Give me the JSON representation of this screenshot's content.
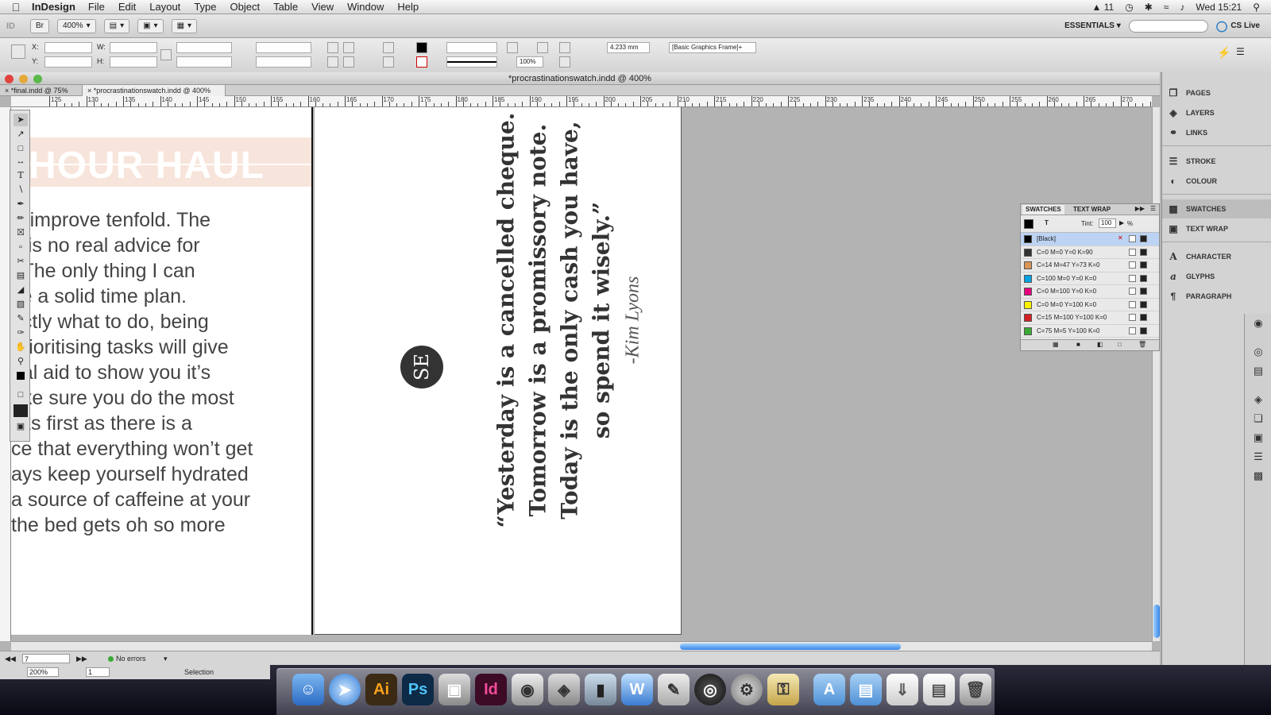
{
  "menubar": {
    "app_name": "InDesign",
    "items": [
      "File",
      "Edit",
      "Layout",
      "Type",
      "Object",
      "Table",
      "View",
      "Window",
      "Help"
    ],
    "status_count": "11",
    "clock": "Wed 15:21"
  },
  "appbar": {
    "id_logo": "ID",
    "bridge": "Br",
    "zoom": "400%",
    "workspace": "ESSENTIALS",
    "cs_live": "CS Live"
  },
  "control": {
    "x_label": "X:",
    "y_label": "Y:",
    "w_label": "W:",
    "h_label": "H:",
    "stroke_weight": "4.233 mm",
    "opacity": "100%",
    "object_style": "[Basic Graphics Frame]+"
  },
  "document": {
    "window_title": "*procrastinationswatch.indd @ 400%",
    "tabs": [
      "*final.indd @ 75%",
      "*procrastinationswatch.indd @ 400%"
    ],
    "ruler_numbers": [
      "125",
      "130",
      "135",
      "140",
      "145",
      "150",
      "155",
      "160",
      "165",
      "170",
      "175",
      "180",
      "185",
      "190",
      "195",
      "200",
      "205",
      "210",
      "215",
      "220",
      "225",
      "230",
      "235",
      "240",
      "245",
      "250",
      "255",
      "260",
      "265",
      "270"
    ],
    "left_page": {
      "headline": "HOUR HAUL",
      "body_lines": [
        "ill improve tenfold.  The",
        "e is no real advice for",
        ".  The only thing I can",
        "ke a solid time plan.",
        "actly what to do, being",
        " prioritising tasks will give",
        "ual aid to show you it’s",
        "ake sure you do the most",
        "sks first as there is a",
        "ce that everything won’t get",
        "ays keep yourself hydrated",
        "a source of caffeine at your",
        " the bed gets oh so more"
      ]
    },
    "right_page": {
      "logo_text": "SE",
      "quote_lines": [
        "“Yesterday is a cancelled cheque.",
        "Tomorrow is a promissory note.",
        "Today is the only cash you have,",
        "so spend it wisely.”"
      ],
      "author": "-Kim Lyons"
    },
    "status": {
      "page": "7",
      "errors": "No errors"
    }
  },
  "swatches_panel": {
    "tabs": [
      "SWATCHES",
      "TEXT WRAP"
    ],
    "tint_label": "Tint:",
    "tint_value": "100",
    "tint_unit": "%",
    "rows": [
      {
        "name": "[Black]",
        "color": "#000000"
      },
      {
        "name": "C=0 M=0 Y=0 K=90",
        "color": "#333333"
      },
      {
        "name": "C=14 M=47 Y=73 K=0",
        "color": "#d9955a"
      },
      {
        "name": "C=100 M=0 Y=0 K=0",
        "color": "#00a3e0"
      },
      {
        "name": "C=0 M=100 Y=0 K=0",
        "color": "#e4007c"
      },
      {
        "name": "C=0 M=0 Y=100 K=0",
        "color": "#fff200"
      },
      {
        "name": "C=15 M=100 Y=100 K=0",
        "color": "#d31f26"
      },
      {
        "name": "C=75 M=5 Y=100 K=0",
        "color": "#3aa935"
      }
    ]
  },
  "panel_dock": {
    "items": [
      "PAGES",
      "LAYERS",
      "LINKS",
      "STROKE",
      "COLOUR",
      "SWATCHES",
      "TEXT WRAP",
      "CHARACTER",
      "GLYPHS",
      "PARAGRAPH"
    ]
  },
  "app_status": {
    "zoom": "200%",
    "page": "1",
    "tool": "Selection"
  },
  "dock_apps": {
    "illustrator": "Ai",
    "photoshop": "Ps",
    "indesign": "Id"
  },
  "colors": {
    "headline_band": "#f7e4da",
    "accent_blue": "#3a86e6"
  }
}
